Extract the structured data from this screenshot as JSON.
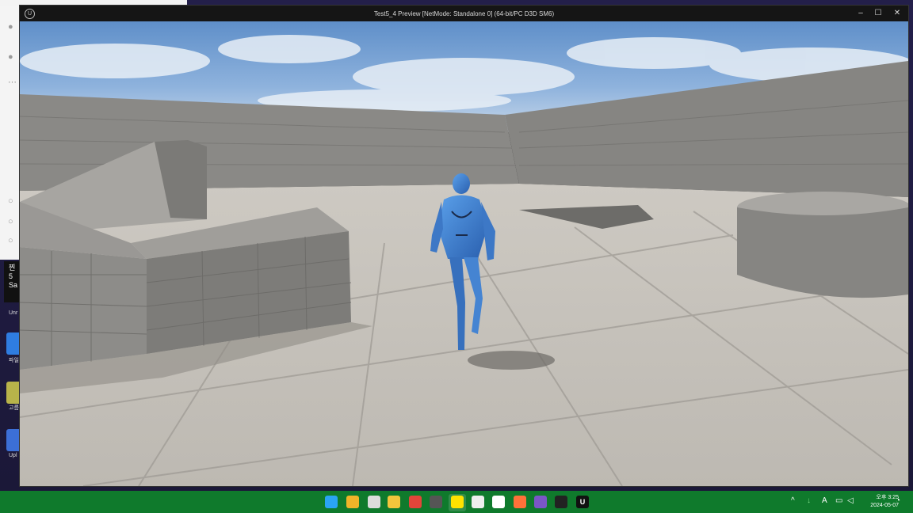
{
  "window": {
    "title": "Test5_4 Preview [NetMode: Standalone 0]  (64-bit/PC D3D SM6)",
    "logo_icon": "unreal-engine-icon",
    "controls": {
      "minimize": "–",
      "maximize": "☐",
      "close": "✕"
    }
  },
  "desktop": {
    "notification_lines": [
      "찐",
      "5",
      "Sa"
    ],
    "icons": [
      {
        "name": "unreal-engine",
        "label": "Unr Eng",
        "color": "#1e1e1e"
      },
      {
        "name": "file-app",
        "label": "파일",
        "color": "#2f7de1"
      },
      {
        "name": "app",
        "label": "고름",
        "color": "#e9c23a"
      },
      {
        "name": "upload",
        "label": "Upl",
        "color": "#3c6fd6"
      }
    ]
  },
  "taskbar": {
    "icons": [
      {
        "name": "start-icon",
        "glyph": "",
        "color": "#2aa4f4"
      },
      {
        "name": "widgets-icon",
        "glyph": "",
        "color": "#f0b429"
      },
      {
        "name": "task-view-icon",
        "glyph": "",
        "color": "#dcdcdc"
      },
      {
        "name": "file-explorer-icon",
        "glyph": "",
        "color": "#f3c53c"
      },
      {
        "name": "chrome-icon",
        "glyph": "",
        "color": "#e3453a"
      },
      {
        "name": "notepad-icon",
        "glyph": "",
        "color": "#555555"
      },
      {
        "name": "kakaotalk-icon",
        "glyph": "",
        "color": "#ffe200"
      },
      {
        "name": "app-icon",
        "glyph": "",
        "color": "#eeeeee"
      },
      {
        "name": "github-icon",
        "glyph": "",
        "color": "#ffffff"
      },
      {
        "name": "firefox-icon",
        "glyph": "",
        "color": "#ff7139"
      },
      {
        "name": "visual-studio-icon",
        "glyph": "",
        "color": "#7a56c7"
      },
      {
        "name": "davinci-icon",
        "glyph": "",
        "color": "#222222"
      },
      {
        "name": "unreal-editor-icon",
        "glyph": "U",
        "color": "#111111"
      }
    ],
    "tray": {
      "chevron": "^",
      "ime": "A",
      "clock_time": "오후 3:25",
      "clock_date": "2024-05-07"
    }
  },
  "colors": {
    "taskbar": "#0f7a2c",
    "sky_top": "#5f8fc9",
    "floor": "#c2beb7",
    "character": "#3a7fd0"
  }
}
